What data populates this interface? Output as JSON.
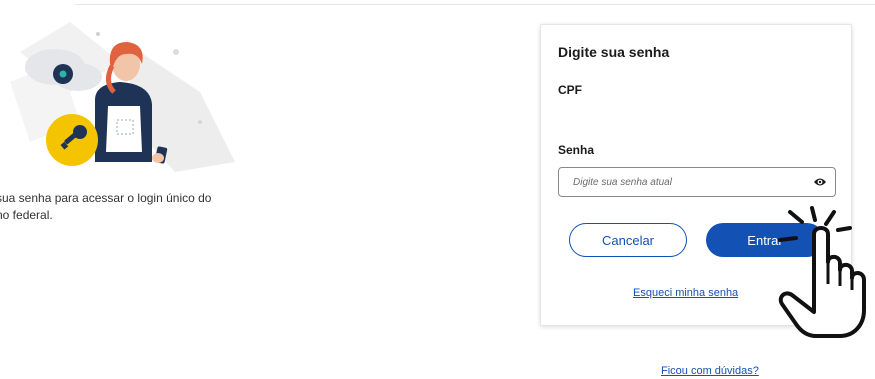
{
  "intro": {
    "line1": "sua senha para acessar o login único do",
    "line2": "no federal."
  },
  "card": {
    "title": "Digite sua senha",
    "cpf_label": "CPF",
    "senha_label": "Senha",
    "senha_placeholder": "Digite sua senha atual",
    "cancel_label": "Cancelar",
    "enter_label": "Entrar",
    "forgot_link": "Esqueci minha senha"
  },
  "footer": {
    "doubts_link": "Ficou com dúvidas?"
  },
  "colors": {
    "primary": "#1351b4",
    "key_badge": "#f5c400"
  },
  "icons": [
    "eye-icon",
    "key-icon",
    "pointing-hand-icon"
  ]
}
